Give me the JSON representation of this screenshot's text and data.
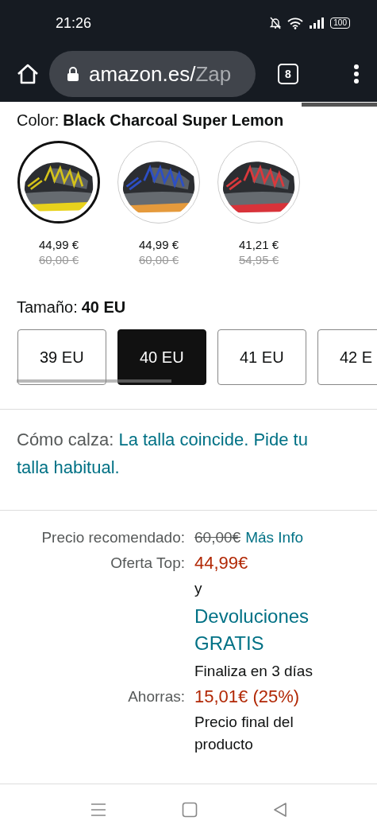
{
  "status_bar": {
    "time": "21:26",
    "battery": "100"
  },
  "browser": {
    "url_host": "amazon.es/",
    "url_path": "Zap",
    "tab_count": "8"
  },
  "color": {
    "label": "Color:",
    "value": "Black Charcoal Super Lemon"
  },
  "swatches": [
    {
      "selected": true,
      "price": "44,99 €",
      "list_price": "60,00 €"
    },
    {
      "selected": false,
      "price": "44,99 €",
      "list_price": "60,00 €"
    },
    {
      "selected": false,
      "price": "41,21 €",
      "list_price": "54,95 €"
    }
  ],
  "size": {
    "label": "Tamaño:",
    "value": "40 EU"
  },
  "sizes": [
    {
      "label": "39 EU",
      "selected": false
    },
    {
      "label": "40 EU",
      "selected": true
    },
    {
      "label": "41 EU",
      "selected": false
    },
    {
      "label": "42 E",
      "selected": false
    }
  ],
  "fit": {
    "label": "Cómo calza:",
    "value": "La talla coincide. Pide tu talla habitual."
  },
  "price_rows": [
    {
      "label": "Precio recomendado:",
      "items": [
        {
          "kind": "strike",
          "text": "60,00€"
        },
        {
          "kind": "link",
          "text": "Más Info"
        }
      ]
    },
    {
      "label": "Oferta Top:",
      "items": [
        {
          "kind": "deal",
          "text": "44,99€"
        }
      ]
    },
    {
      "items": [
        {
          "kind": "text",
          "text": "y"
        }
      ]
    },
    {
      "items": [
        {
          "kind": "biglink",
          "text": "Devoluciones GRATIS"
        }
      ]
    },
    {
      "items": [
        {
          "kind": "text",
          "text": "Finaliza en 3 días"
        }
      ]
    },
    {
      "label": "Ahorras:",
      "items": [
        {
          "kind": "deal",
          "text": "15,01€ (25%)"
        }
      ]
    },
    {
      "items": [
        {
          "kind": "text",
          "text": "Precio final del producto"
        }
      ]
    }
  ]
}
